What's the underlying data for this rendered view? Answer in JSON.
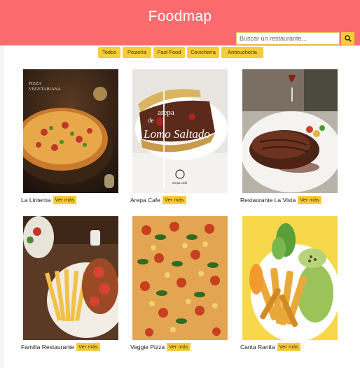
{
  "header": {
    "title": "Foodmap"
  },
  "search": {
    "placeholder": "Buscar un restaurante...",
    "icon": "search-icon"
  },
  "filters": [
    "Todos",
    "Pizzería",
    "Fast Food",
    "Cevichería",
    "Anticuchería"
  ],
  "cards": [
    {
      "name": "La Linterna",
      "more": "Ver más",
      "image_text": [
        "PIZZA",
        "VEGETARIANA"
      ]
    },
    {
      "name": "Arepa Cafe",
      "more": "Ver más",
      "image_text": [
        "arepa",
        "de",
        "Lomo Saltado",
        "arepa café"
      ]
    },
    {
      "name": "Restaurante La Vista",
      "more": "Ver más"
    },
    {
      "name": "Familia Restaurante",
      "more": "Ver más"
    },
    {
      "name": "Veggie Pizza",
      "more": "Ver más"
    },
    {
      "name": "Canta Ranita",
      "more": "Ver más"
    }
  ],
  "colors": {
    "header": "#fb6b6e",
    "accent": "#f7cc3c"
  }
}
